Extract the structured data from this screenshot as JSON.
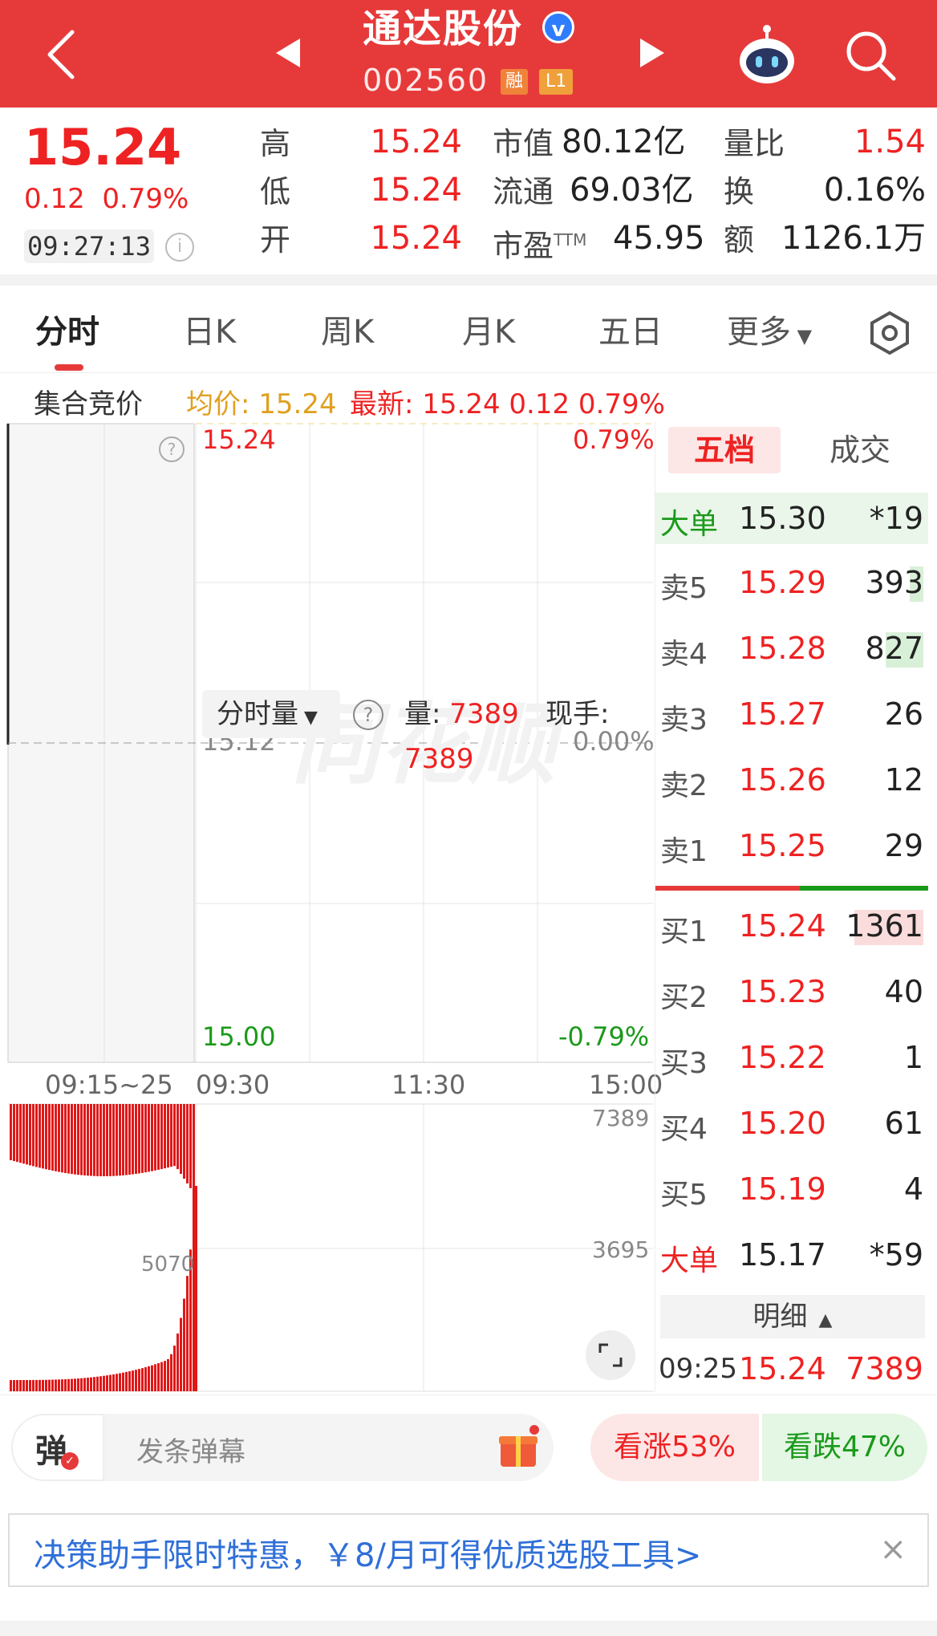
{
  "header": {
    "stock_name": "通达股份",
    "verified_badge": "v",
    "stock_code": "002560",
    "tag_margin": "融",
    "tag_level": "L1",
    "bg_color": "#e63a3a"
  },
  "quote": {
    "price": "15.24",
    "change": "0.12",
    "change_pct": "0.79%",
    "time": "09:27:13",
    "stats": [
      {
        "label": "高",
        "value": "15.24"
      },
      {
        "label": "低",
        "value": "15.24"
      },
      {
        "label": "开",
        "value": "15.24"
      }
    ],
    "market_cap_label": "市值",
    "market_cap": "80.12亿",
    "float_cap_label": "流通",
    "float_cap": "69.03亿",
    "pe_label": "市盈",
    "pe_sup": "TTM",
    "pe": "45.95",
    "vol_ratio_label": "量比",
    "vol_ratio": "1.54",
    "turnover_label": "换",
    "turnover": "0.16%",
    "amount_label": "额",
    "amount": "1126.1万"
  },
  "tabs": [
    "分时",
    "日K",
    "周K",
    "月K",
    "五日",
    "更多"
  ],
  "infoline": {
    "auction": "集合竞价",
    "avg": "均价: 15.24",
    "latest": "最新: 15.24  0.12  0.79%"
  },
  "chart": {
    "price_high": "15.24",
    "price_mid": "15.12",
    "price_low": "15.00",
    "pct_high": "0.79%",
    "pct_mid": "0.00%",
    "pct_low": "-0.79%",
    "time_auction": "09:15~25",
    "time_open": "09:30",
    "time_mid": "11:30",
    "time_close": "15:00",
    "volume_selector": "分时量",
    "volume_label": "量:",
    "volume_value": "7389",
    "volume_value_2": "7389",
    "current_hand_label": "现手:",
    "vol_axis_max": "7389",
    "vol_axis_mid": "3695",
    "auction_vol_label": "5070",
    "watermark": "同花顺"
  },
  "orderbook": {
    "tab_active": "五档",
    "tab_other": "成交",
    "big_sell": {
      "label": "大单",
      "price": "15.30",
      "vol": "*19"
    },
    "asks": [
      {
        "label": "卖5",
        "price": "15.29",
        "vol": "393",
        "bar": 0.2
      },
      {
        "label": "卖4",
        "price": "15.28",
        "vol": "827",
        "bar": 0.55
      },
      {
        "label": "卖3",
        "price": "15.27",
        "vol": "26",
        "bar": 0
      },
      {
        "label": "卖2",
        "price": "15.26",
        "vol": "12",
        "bar": 0
      },
      {
        "label": "卖1",
        "price": "15.25",
        "vol": "29",
        "bar": 0
      }
    ],
    "bids": [
      {
        "label": "买1",
        "price": "15.24",
        "vol": "1361",
        "bar": 1.0
      },
      {
        "label": "买2",
        "price": "15.23",
        "vol": "40",
        "bar": 0
      },
      {
        "label": "买3",
        "price": "15.22",
        "vol": "1",
        "bar": 0
      },
      {
        "label": "买4",
        "price": "15.20",
        "vol": "61",
        "bar": 0
      },
      {
        "label": "买5",
        "price": "15.19",
        "vol": "4",
        "bar": 0
      }
    ],
    "big_buy": {
      "label": "大单",
      "price": "15.17",
      "vol": "*59"
    },
    "detail_label": "明细",
    "trade": {
      "time": "09:25",
      "price": "15.24",
      "vol": "7389"
    }
  },
  "bottom": {
    "danmu_icon": "弹",
    "danmu_placeholder": "发条弹幕",
    "vote_up": "看涨53%",
    "vote_down": "看跌47%"
  },
  "promo": {
    "text": "决策助手限时特惠，￥8/月可得优质选股工具>",
    "close": "×"
  }
}
